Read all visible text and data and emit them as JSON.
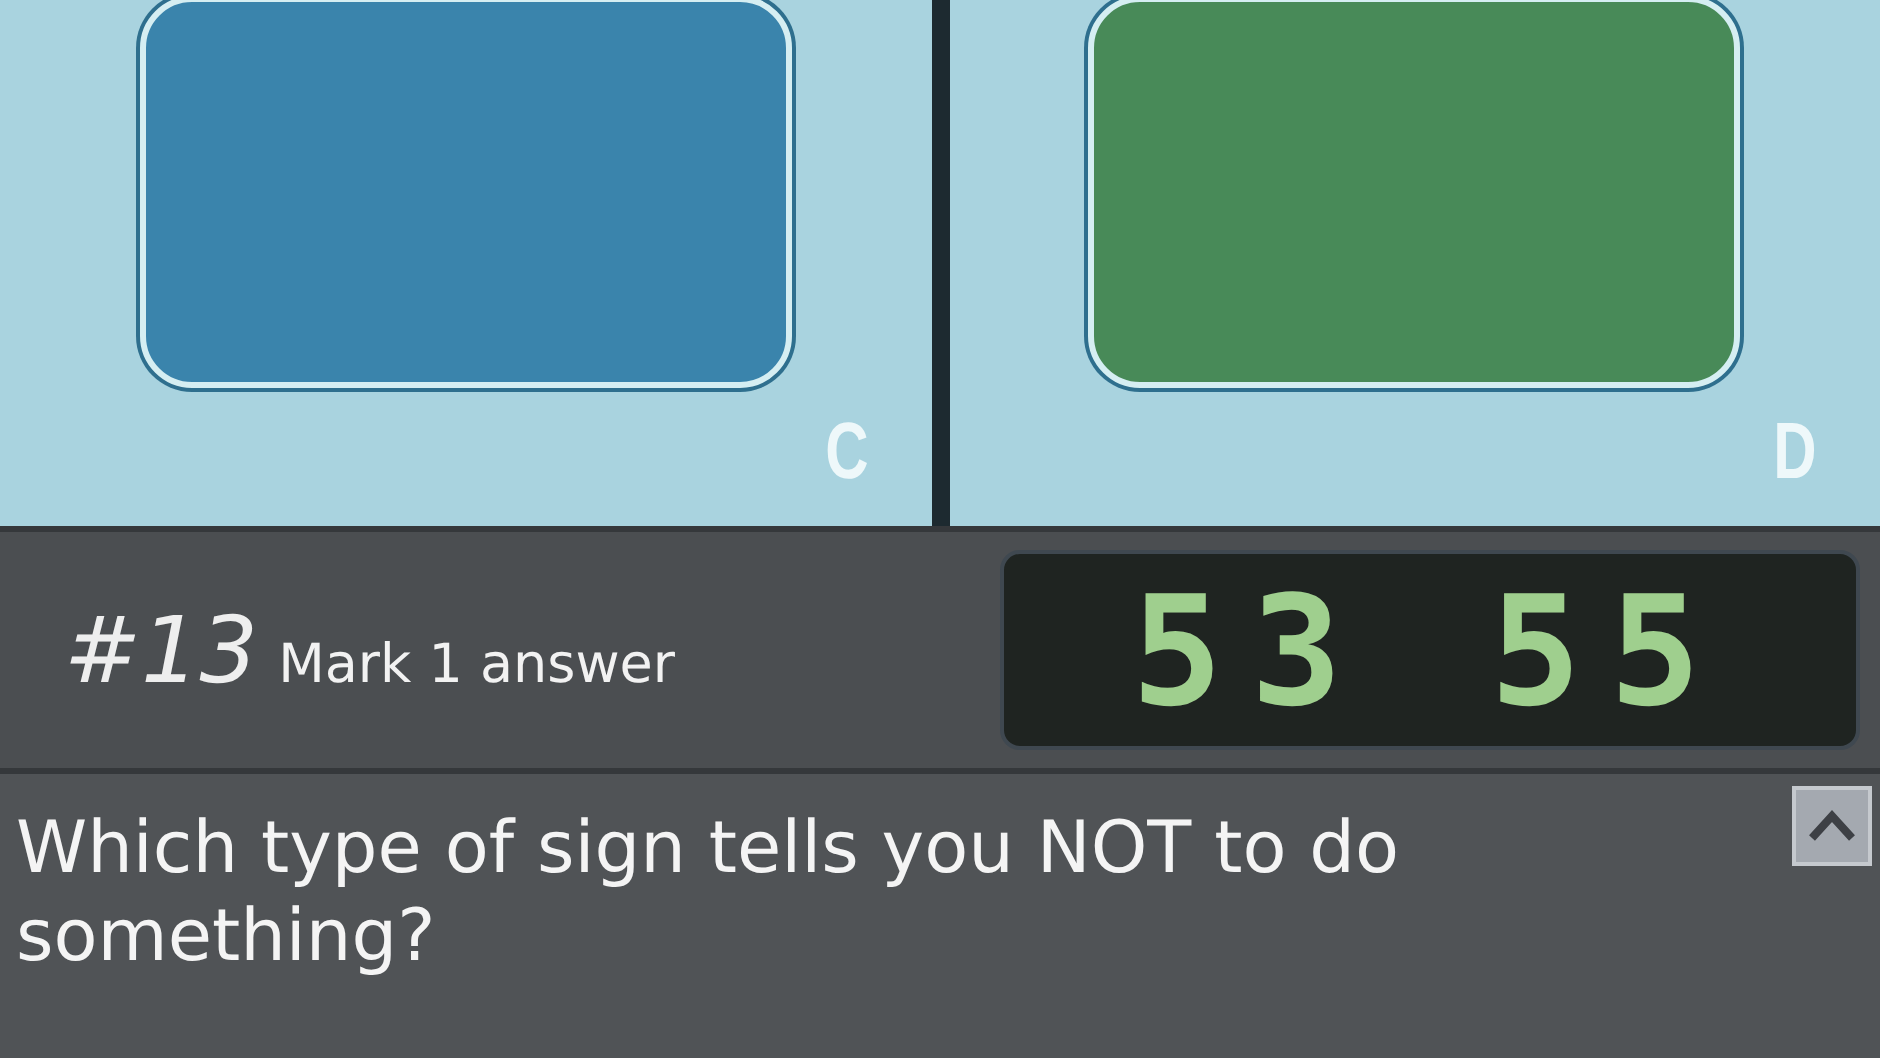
{
  "options": [
    {
      "letter": "C",
      "color": "#3a84ac"
    },
    {
      "letter": "D",
      "color": "#488a58"
    }
  ],
  "question_bar": {
    "number": "#13",
    "instruction": "Mark 1 answer",
    "timer": "53 55"
  },
  "question": {
    "text": "Which type of sign tells you NOT to do something?"
  }
}
